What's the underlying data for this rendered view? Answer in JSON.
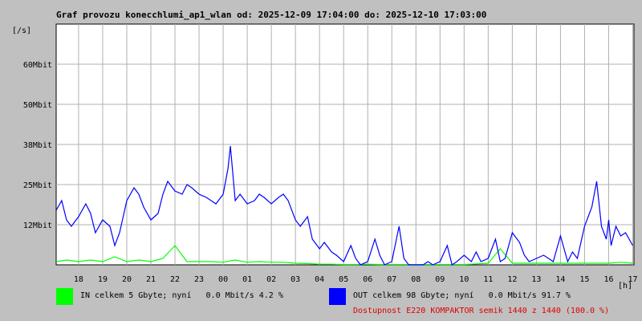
{
  "chart_data": {
    "type": "line",
    "title": "Graf provozu konecchlumi_ap1_wlan od: 2025-12-09 17:04:00 do: 2025-12-10 17:03:00",
    "ylabel": "[/s]",
    "xlabel": "[h]",
    "y_ticks": [
      {
        "value": 12.5,
        "label": "12Mbit"
      },
      {
        "value": 25,
        "label": "25Mbit"
      },
      {
        "value": 37.5,
        "label": "38Mbit"
      },
      {
        "value": 50,
        "label": "50Mbit"
      },
      {
        "value": 62.5,
        "label": "60Mbit"
      }
    ],
    "x_ticks": [
      "18",
      "19",
      "20",
      "21",
      "22",
      "23",
      "00",
      "01",
      "02",
      "03",
      "04",
      "05",
      "06",
      "07",
      "08",
      "09",
      "10",
      "11",
      "12",
      "13",
      "14",
      "15",
      "16",
      "17"
    ],
    "x_start_hour": 17.07,
    "x_end_hour": 41.05,
    "ylim": [
      0,
      75
    ],
    "grid": true,
    "series": [
      {
        "name": "OUT",
        "color": "#0000ff",
        "x": [
          17.07,
          17.3,
          17.5,
          17.7,
          18.0,
          18.3,
          18.5,
          18.7,
          19.0,
          19.3,
          19.5,
          19.7,
          20.0,
          20.3,
          20.5,
          20.7,
          21.0,
          21.3,
          21.5,
          21.7,
          22.0,
          22.3,
          22.5,
          22.7,
          23.0,
          23.3,
          23.5,
          23.7,
          24.0,
          24.2,
          24.3,
          24.5,
          24.7,
          25.0,
          25.3,
          25.5,
          25.7,
          26.0,
          26.3,
          26.5,
          26.7,
          27.0,
          27.2,
          27.5,
          27.7,
          28.0,
          28.2,
          28.5,
          28.7,
          29.0,
          29.3,
          29.5,
          29.7,
          30.0,
          30.3,
          30.5,
          30.7,
          31.0,
          31.3,
          31.5,
          31.7,
          32.0,
          32.3,
          32.5,
          32.7,
          33.0,
          33.3,
          33.5,
          33.7,
          34.0,
          34.3,
          34.5,
          34.7,
          35.0,
          35.3,
          35.5,
          35.7,
          36.0,
          36.3,
          36.5,
          36.7,
          37.0,
          37.3,
          37.5,
          37.7,
          38.0,
          38.3,
          38.5,
          38.7,
          39.0,
          39.3,
          39.5,
          39.7,
          39.9,
          40.0,
          40.1,
          40.3,
          40.5,
          40.7,
          41.0
        ],
        "values": [
          17,
          20,
          14,
          12,
          15,
          19,
          16,
          10,
          14,
          12,
          6,
          10,
          20,
          24,
          22,
          18,
          14,
          16,
          22,
          26,
          23,
          22,
          25,
          24,
          22,
          21,
          20,
          19,
          22,
          30,
          37,
          20,
          22,
          19,
          20,
          22,
          21,
          19,
          21,
          22,
          20,
          14,
          12,
          15,
          8,
          5,
          7,
          4,
          3,
          1,
          6,
          2,
          0,
          1,
          8,
          3,
          0,
          1,
          12,
          2,
          0,
          0,
          0,
          1,
          0,
          1,
          6,
          0,
          1,
          3,
          1,
          4,
          1,
          2,
          8,
          1,
          2,
          10,
          7,
          3,
          1,
          2,
          3,
          2,
          1,
          9,
          1,
          4,
          2,
          12,
          18,
          26,
          12,
          8,
          14,
          6,
          12,
          9,
          10,
          6
        ]
      },
      {
        "name": "IN",
        "color": "#00ff00",
        "x": [
          17.07,
          17.5,
          18.0,
          18.5,
          19.0,
          19.5,
          20.0,
          20.5,
          21.0,
          21.5,
          22.0,
          22.5,
          23.0,
          23.5,
          24.0,
          24.5,
          25.0,
          25.5,
          26.0,
          26.5,
          27.0,
          27.5,
          28.0,
          28.5,
          29.0,
          29.5,
          30.0,
          30.5,
          31.0,
          31.5,
          32.0,
          32.5,
          33.0,
          33.5,
          34.0,
          34.5,
          35.0,
          35.5,
          36.0,
          36.5,
          37.0,
          37.5,
          38.0,
          38.5,
          39.0,
          39.5,
          40.0,
          40.5,
          41.0
        ],
        "values": [
          1,
          1.5,
          1,
          1.5,
          1,
          2.5,
          1,
          1.5,
          1,
          2,
          6,
          1,
          1,
          1,
          0.8,
          1.5,
          0.8,
          1,
          0.8,
          0.8,
          0.5,
          0.4,
          0.2,
          0.2,
          0.1,
          0.1,
          0.2,
          0.1,
          0.1,
          0.1,
          0.1,
          0.1,
          0.1,
          0.1,
          0.1,
          0.3,
          0.5,
          5,
          0.5,
          0.5,
          0.5,
          0.5,
          0.5,
          0.5,
          0.5,
          0.5,
          0.5,
          0.8,
          0.5
        ]
      }
    ]
  },
  "legend": {
    "in_text": "IN celkem 5 Gbyte; nyní   0.0 Mbit/s 4.2 %",
    "in_color": "#00ff00",
    "out_text": "OUT celkem 98 Gbyte; nyní   0.0 Mbit/s 91.7 %",
    "out_color": "#0000ff",
    "availability": "Dostupnost E220 KOMPAKTOR semik 1440 z 1440 (100.0 %)"
  }
}
